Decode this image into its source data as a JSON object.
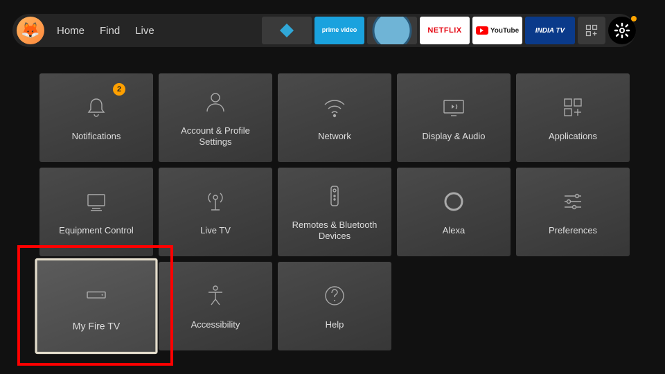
{
  "nav": {
    "home": "Home",
    "find": "Find",
    "live": "Live"
  },
  "apps": {
    "kodi": "Kodi",
    "prime": "prime video",
    "browser": "Browser",
    "netflix": "NETFLIX",
    "youtube": "YouTube",
    "india": "INDIA TV"
  },
  "tiles": {
    "notifications": "Notifications",
    "notifications_badge": "2",
    "account": "Account & Profile Settings",
    "network": "Network",
    "display": "Display & Audio",
    "applications": "Applications",
    "equipment": "Equipment Control",
    "livetv": "Live TV",
    "remotes": "Remotes & Bluetooth Devices",
    "alexa": "Alexa",
    "preferences": "Preferences",
    "myfiretv": "My Fire TV",
    "accessibility": "Accessibility",
    "help": "Help"
  }
}
